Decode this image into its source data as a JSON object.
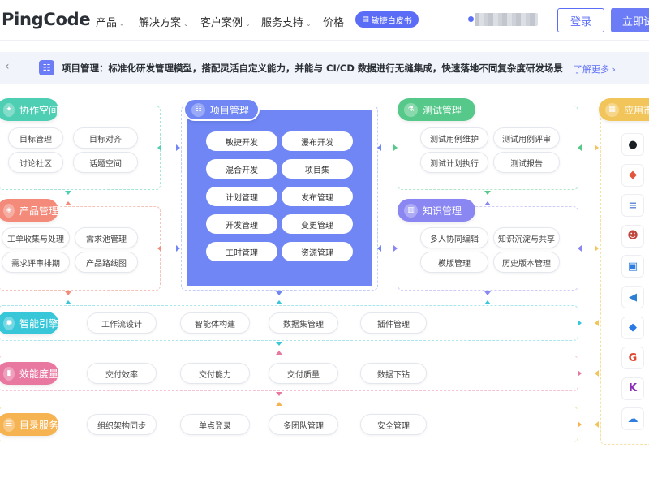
{
  "nav": {
    "logo": "PingCode",
    "items": [
      {
        "label": "产品",
        "has_dropdown": true
      },
      {
        "label": "解决方案",
        "has_dropdown": true
      },
      {
        "label": "客户案例",
        "has_dropdown": true
      },
      {
        "label": "服务支持",
        "has_dropdown": true
      },
      {
        "label": "价格",
        "has_dropdown": false
      }
    ],
    "whitepaper": "敏捷白皮书",
    "login": "登录",
    "trial": "立即试"
  },
  "banner": {
    "text": "项目管理：标准化研发管理模型，搭配灵活自定义能力，并能与 CI/CD 数据进行无缝集成，快速落地不同复杂度研发场景",
    "more": "了解更多"
  },
  "colors": {
    "accent": "#5b6df7",
    "collab": "#4ecfb4",
    "product": "#f38a7a",
    "pm": "#6f86f4",
    "test": "#56c98a",
    "knowledge": "#8a86f2",
    "ai": "#37c7d8",
    "metrics": "#e878a0",
    "directory": "#f6b351",
    "apps": "#f2c55a"
  },
  "modules": {
    "collab": {
      "title": "协作空间",
      "items": [
        "目标管理",
        "目标对齐",
        "讨论社区",
        "话题空间"
      ]
    },
    "product": {
      "title": "产品管理",
      "items": [
        "工单收集与处理",
        "需求池管理",
        "需求评审排期",
        "产品路线图"
      ]
    },
    "pm": {
      "title": "项目管理",
      "items": [
        "敏捷开发",
        "瀑布开发",
        "混合开发",
        "项目集",
        "计划管理",
        "发布管理",
        "开发管理",
        "变更管理",
        "工时管理",
        "资源管理"
      ]
    },
    "test": {
      "title": "测试管理",
      "items": [
        "测试用例维护",
        "测试用例评审",
        "测试计划执行",
        "测试报告"
      ]
    },
    "knowledge": {
      "title": "知识管理",
      "items": [
        "多人协同编辑",
        "知识沉淀与共享",
        "模版管理",
        "历史版本管理"
      ]
    },
    "apps": {
      "title": "应用市"
    },
    "ai": {
      "title": "智能引擎",
      "items": [
        "工作流设计",
        "智能体构建",
        "数据集管理",
        "插件管理"
      ]
    },
    "metrics": {
      "title": "效能度量",
      "items": [
        "交付效率",
        "交付能力",
        "交付质量",
        "数据下钻"
      ]
    },
    "directory": {
      "title": "目录服务",
      "items": [
        "组织架构同步",
        "单点登录",
        "多团队管理",
        "安全管理"
      ]
    }
  },
  "app_icons": [
    {
      "name": "github-icon",
      "glyph": "●",
      "color": "#1b1f23"
    },
    {
      "name": "gitlab-icon",
      "glyph": "◆",
      "color": "#e2563b"
    },
    {
      "name": "list-app-icon",
      "glyph": "≡",
      "color": "#6a8fd8"
    },
    {
      "name": "jenkins-icon",
      "glyph": "☻",
      "color": "#c0453a"
    },
    {
      "name": "bucket-icon",
      "glyph": "▣",
      "color": "#2f7de1"
    },
    {
      "name": "vscode-icon",
      "glyph": "◀",
      "color": "#2d7fd3"
    },
    {
      "name": "diamond-app-icon",
      "glyph": "◆",
      "color": "#2a78e4"
    },
    {
      "name": "g-app-icon",
      "glyph": "G",
      "color": "#e0452e"
    },
    {
      "name": "k-app-icon",
      "glyph": "K",
      "color": "#8b2fb8"
    },
    {
      "name": "cloud-icon",
      "glyph": "☁",
      "color": "#2f7de1"
    }
  ]
}
